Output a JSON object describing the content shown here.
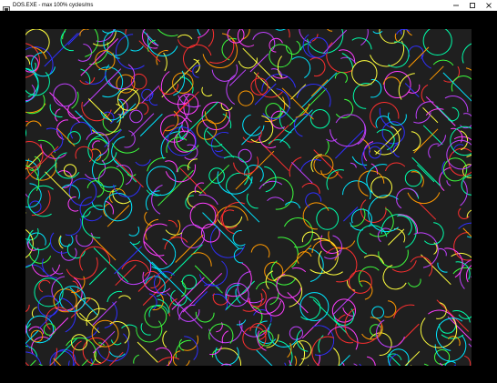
{
  "window": {
    "title": "DOS.EXE - max 100% cycles/ms",
    "app_icon": "dosbox-app-icon",
    "controls": {
      "minimize_icon": "minimize-icon",
      "maximize_icon": "maximize-icon",
      "close_icon": "close-icon"
    }
  },
  "display": {
    "content": "random colored arcs, circles and diagonal lines pattern",
    "background_color": "#1f1f1f",
    "border_color": "#000000",
    "palette": [
      "#ff3dff",
      "#00e5ff",
      "#3dff3d",
      "#ffff3d",
      "#ff2f2f",
      "#2f2fff",
      "#ff9900",
      "#c040ff",
      "#00ffaa"
    ]
  }
}
